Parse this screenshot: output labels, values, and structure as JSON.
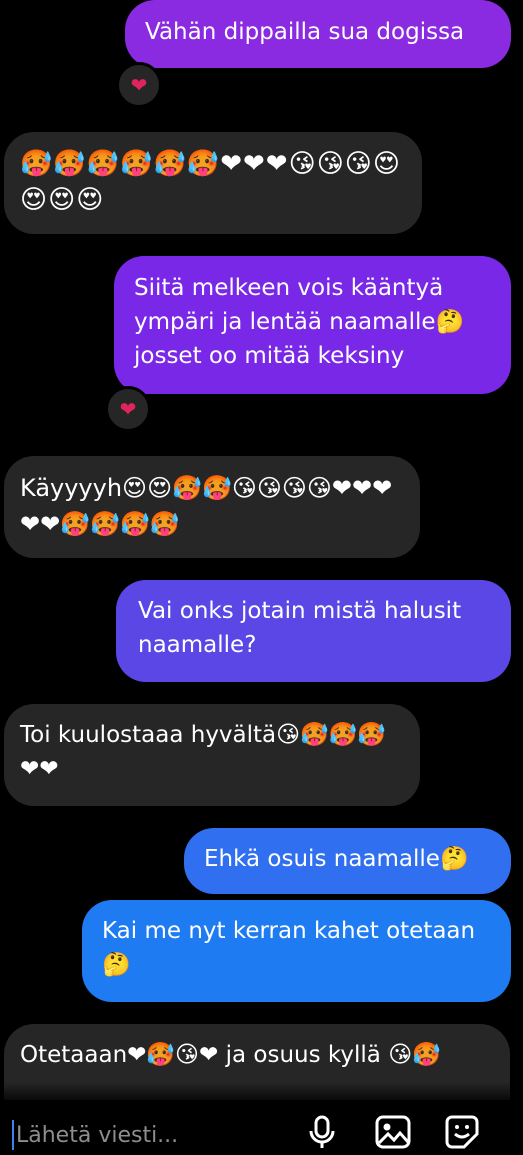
{
  "messages": [
    {
      "text": "Vähän dippailla sua dogissa",
      "side": "sent",
      "color": "#8a2be2"
    },
    {
      "text": "🥵🥵🥵🥵🥵🥵❤❤❤😘😘😘😍😍😍😍",
      "side": "received"
    },
    {
      "text": "Siitä melkeen vois kääntyä ympäri ja lentää naamalle🤔 josset oo mitää keksiny",
      "side": "sent",
      "color": "#7a28e8"
    },
    {
      "text": "Käyyyyh😍😍🥵🥵😘😘😘😘❤❤❤❤❤🥵🥵🥵🥵",
      "side": "received"
    },
    {
      "text": "Vai onks jotain mistä halusit naamalle?",
      "side": "sent",
      "color": "#5b47e6"
    },
    {
      "text": "Toi kuulostaaa hyvältä😘🥵🥵🥵❤❤",
      "side": "received"
    },
    {
      "text": "Ehkä osuis naamalle🤔",
      "side": "sent",
      "color": "#2f6ff0"
    },
    {
      "text": "Kai me nyt kerran kahet otetaan 🤔",
      "side": "sent",
      "color": "#1e7bf2"
    },
    {
      "text": "Otetaaan❤🥵😘❤ ja osuus kyllä 😘🥵",
      "side": "received"
    }
  ],
  "reactions": [
    "❤",
    "❤"
  ],
  "composer": {
    "placeholder": "Lähetä viesti...",
    "icons": [
      "microphone-icon",
      "image-icon",
      "sticker-icon"
    ]
  }
}
